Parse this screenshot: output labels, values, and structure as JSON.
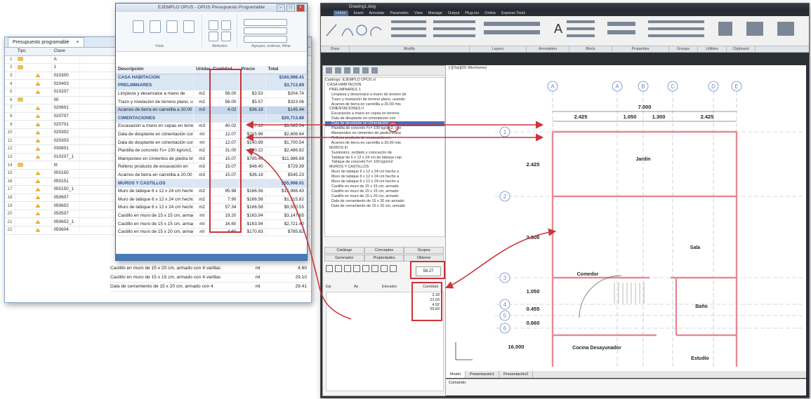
{
  "spreadsheet": {
    "tab_label": "Presupuesto programable",
    "tab_close": "×",
    "columns": [
      "Tipo",
      "Clave"
    ],
    "rows": [
      {
        "n": "1",
        "clave": "A"
      },
      {
        "n": "2",
        "clave": "1"
      },
      {
        "n": "3",
        "clave": "010300"
      },
      {
        "n": "4",
        "clave": "020403"
      },
      {
        "n": "5",
        "clave": "010207"
      },
      {
        "n": "6",
        "clave": "00"
      },
      {
        "n": "7",
        "clave": "020601"
      },
      {
        "n": "8",
        "clave": "020707"
      },
      {
        "n": "9",
        "clave": "020701"
      },
      {
        "n": "10",
        "clave": "020302"
      },
      {
        "n": "11",
        "clave": "020303"
      },
      {
        "n": "12",
        "clave": "030801"
      },
      {
        "n": "13",
        "clave": "010207_1"
      },
      {
        "n": "14",
        "clave": "III"
      },
      {
        "n": "15",
        "clave": "050150"
      },
      {
        "n": "16",
        "clave": "050151"
      },
      {
        "n": "17",
        "clave": "050150_1"
      },
      {
        "n": "18",
        "clave": "050607"
      },
      {
        "n": "19",
        "clave": "050602"
      },
      {
        "n": "20",
        "clave": "050507"
      },
      {
        "n": "21",
        "clave": "050602_1"
      },
      {
        "n": "22",
        "clave": "050604"
      }
    ],
    "bottom_rows": [
      {
        "desc": "Castillo en muro de 15 x 20 cm, armado con 4 varillas",
        "unit": "ml",
        "value": "4.60"
      },
      {
        "desc": "Castillo en muro de 15 x 15 cm, armado con 4 varillas",
        "unit": "ml",
        "value": "29.10"
      },
      {
        "desc": "Dala de cerramiento de 15 x 20 cm, armado con 4",
        "unit": "ml",
        "value": "29.41"
      }
    ]
  },
  "budget": {
    "title": "EJEMPLO OPUS - OPUS Presupuesto Programable",
    "ribbon_groups": [
      "Vista",
      "Atributos",
      "Agrupar, ordenar, filtrar"
    ],
    "columns": [
      "Descripción",
      "Unidad",
      "Cantidad",
      "Precio",
      "Total"
    ],
    "rows": [
      {
        "desc": "CASA HABITACION",
        "unit": "",
        "qty": "",
        "price": "",
        "total": "$160,998.41",
        "style": "blue"
      },
      {
        "desc": "PRELIMINARES",
        "unit": "",
        "qty": "",
        "price": "",
        "total": "$3,713.89",
        "style": "blue"
      },
      {
        "desc": "Limpieza y desenraice a mano de",
        "unit": "m2",
        "qty": "58.00",
        "price": "$3.53",
        "total": "$204.74",
        "style": ""
      },
      {
        "desc": "Trazo y nivelación de terreno plano, usando",
        "unit": "m2",
        "qty": "58.00",
        "price": "$5.57",
        "total": "$323.06",
        "style": ""
      },
      {
        "desc": "Acarreo de tierra en carretilla a 20.00 mts",
        "unit": "m3",
        "qty": "4.02",
        "price": "$36.18",
        "total": "$145.44",
        "style": "sel"
      },
      {
        "desc": "CIMENTACIONES",
        "unit": "",
        "qty": "",
        "price": "",
        "total": "$20,713.88",
        "style": "blue"
      },
      {
        "desc": "Excavación a mano en cepas en terreno",
        "unit": "m3",
        "qty": "40.02",
        "price": "$77.10",
        "total": "$3,085.54",
        "style": ""
      },
      {
        "desc": "Dala de desplante en cimentación con",
        "unit": "ml",
        "qty": "12.07",
        "price": "$215.96",
        "total": "$2,606.64",
        "style": ""
      },
      {
        "desc": "Dala de desplante en cimentación con",
        "unit": "ml",
        "qty": "12.07",
        "price": "$140.89",
        "total": "$1,700.54",
        "style": ""
      },
      {
        "desc": "Plantilla de concreto f'c= 100 kg/cm2, con",
        "unit": "m2",
        "qty": "31.00",
        "price": "$80.22",
        "total": "$2,486.82",
        "style": ""
      },
      {
        "desc": "Mamposteo en cimientos de piedra brasa de",
        "unit": "m3",
        "qty": "15.07",
        "price": "$795.40",
        "total": "$11,986.68",
        "style": ""
      },
      {
        "desc": "Relleno producto de excavación en",
        "unit": "m3",
        "qty": "15.07",
        "price": "$48.40",
        "total": "$729.39",
        "style": ""
      },
      {
        "desc": "Acarreo de tierra en carretilla a 20.00 mts",
        "unit": "m3",
        "qty": "15.07",
        "price": "$36.18",
        "total": "$545.23",
        "style": ""
      },
      {
        "desc": "MUROS Y CASTILLOS",
        "unit": "",
        "qty": "",
        "price": "",
        "total": "$55,998.01",
        "style": "blue"
      },
      {
        "desc": "Muro de tabique 6 x 12 x 24 cm hecho a",
        "unit": "m2",
        "qty": "95.98",
        "price": "$166.56",
        "total": "$15,986.43",
        "style": ""
      },
      {
        "desc": "Muro de tabique 6 x 12 x 24 cm hecho a",
        "unit": "m2",
        "qty": "7.90",
        "price": "$166.56",
        "total": "$1,315.82",
        "style": ""
      },
      {
        "desc": "Muro de tabique 6 x 12 x 24 cm hecho a",
        "unit": "m2",
        "qty": "57.34",
        "price": "$166.56",
        "total": "$9,550.55",
        "style": ""
      },
      {
        "desc": "Castillo en muro de 15 x 15 cm, armado con",
        "unit": "ml",
        "qty": "19.20",
        "price": "$163.94",
        "total": "$3,147.65",
        "style": ""
      },
      {
        "desc": "Castillo en muro de 15 x 15 cm, armado con",
        "unit": "ml",
        "qty": "16.60",
        "price": "$163.94",
        "total": "$2,721.40",
        "style": ""
      },
      {
        "desc": "Castillo en muro de 15 x 20 cm, armado con",
        "unit": "ml",
        "qty": "4.60",
        "price": "$170.83",
        "total": "$785.82",
        "style": ""
      }
    ]
  },
  "cad": {
    "title": "Drawing1.dwg",
    "menu": [
      "Home",
      "Insert",
      "Annotate",
      "Parametric",
      "View",
      "Manage",
      "Output",
      "Plug-ins",
      "Online",
      "Express Tools"
    ],
    "ribbon_groups": [
      "Draw",
      "Modify",
      "Layers",
      "Annotation",
      "Block",
      "Properties",
      "Groups",
      "Utilities",
      "Clipboard"
    ],
    "viewport_label": "[-][Top][2D Wireframe]",
    "tree_title": "Catálogo: EJEMPLO OPUS",
    "tree_items": [
      "Catálogo: EJEMPLO OPUS xl",
      "  CASA HABITACION",
      "    PRELIMINARES 1",
      "      Limpieza y desenraice a mano de terreno de",
      "      Trazo y nivelación de terreno plano, usando",
      "      Acarreo de tierra en carretilla a 20.00 mts",
      "    CIMENTACIONES II",
      "      Excavación a mano en cepas en terreno",
      "      Dala de desplante en cimentación con",
      "      Dala de desplante en cimentación con",
      "      Plantilla de concreto f'c= 100 kg/cm2, con",
      "      Mamposteo en cimientos de piedra brasa",
      "      Relleno producto de excavación en",
      "      Acarreo de tierra en carretilla a 20.00 mts",
      "    MUROS III",
      "      Suministro, recibido y colocación de",
      "      Tabique de 6 x 12 x 24 cm de tabique rojo",
      "      Tabique de concreto f'c= 100 kg/cm2",
      "    MUROS Y CASTILLOS",
      "      Muro de tabique 6 x 12 x 24 cm hecho a",
      "      Muro de tabique 6 x 12 x 24 cm hecho a",
      "      Muro de tabique 6 x 12 x 24 cm hecho a",
      "      Castillo en muro de 15 x 15 cm, armado",
      "      Castillo en muro de 15 x 15 cm, armado",
      "      Castillo en muro de 15 x 20 cm, armado",
      "      Dala de cerramiento de 15 x 20 cm armado",
      "      Dala de cerramiento de 15 x 20 cm, armado"
    ],
    "panel_tabs_a": [
      "Catálogo",
      "Conceptos",
      "Grupos"
    ],
    "panel_tabs_b": [
      "Generador",
      "Propiedades",
      "Obtener"
    ],
    "value_field": "58.27",
    "mini_cols": [
      "Eje",
      "Ay",
      "Elevador",
      "Cantidad"
    ],
    "mini_values": [
      "2.18",
      "21.03",
      "4.92",
      "59.83"
    ],
    "layout_tabs": [
      "Model",
      "Presentación1",
      "Presentación2"
    ],
    "command_label": "Comando:",
    "grid_cols": [
      "A",
      "A",
      "B",
      "C",
      "D",
      "E"
    ],
    "grid_rows": [
      "1",
      "2",
      "3",
      "4",
      "5",
      "6"
    ],
    "dims_top": [
      "7.000",
      "2.425",
      "1.050",
      "1.300",
      "2.425"
    ],
    "dims_left": [
      "2.425",
      "2.900",
      "1.050",
      "0.455",
      "0.660",
      "16.000"
    ],
    "rooms": [
      "Jardín",
      "Sala",
      "Comedor",
      "Baño",
      "Cocina Desayunador",
      "Estudio"
    ]
  },
  "colors": {
    "highlight": "#c8363c",
    "ribbon_blue": "#4a7bb7",
    "cad_wall": "#e58a93",
    "cad_grid": "#6a8bbf"
  }
}
